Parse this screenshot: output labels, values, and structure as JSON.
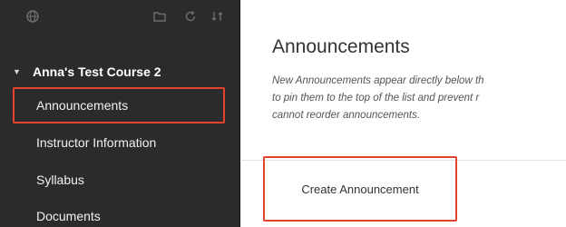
{
  "sidebar": {
    "top_icons": [
      "globe-icon",
      "folder-icon",
      "refresh-icon",
      "swap-arrows-icon"
    ],
    "course_title": "Anna's Test Course 2",
    "items": [
      {
        "label": "Announcements",
        "selected": true
      },
      {
        "label": "Instructor Information",
        "selected": false
      },
      {
        "label": "Syllabus",
        "selected": false
      },
      {
        "label": "Documents",
        "selected": false
      }
    ]
  },
  "main": {
    "title": "Announcements",
    "description_lines": [
      "New Announcements appear directly below th",
      "to pin them to the top of the list and prevent r",
      "cannot reorder announcements."
    ],
    "create_button_label": "Create Announcement"
  },
  "colors": {
    "sidebar_bg": "#2b2b2b",
    "highlight_red": "#e3422b",
    "text_dark": "#333333"
  }
}
